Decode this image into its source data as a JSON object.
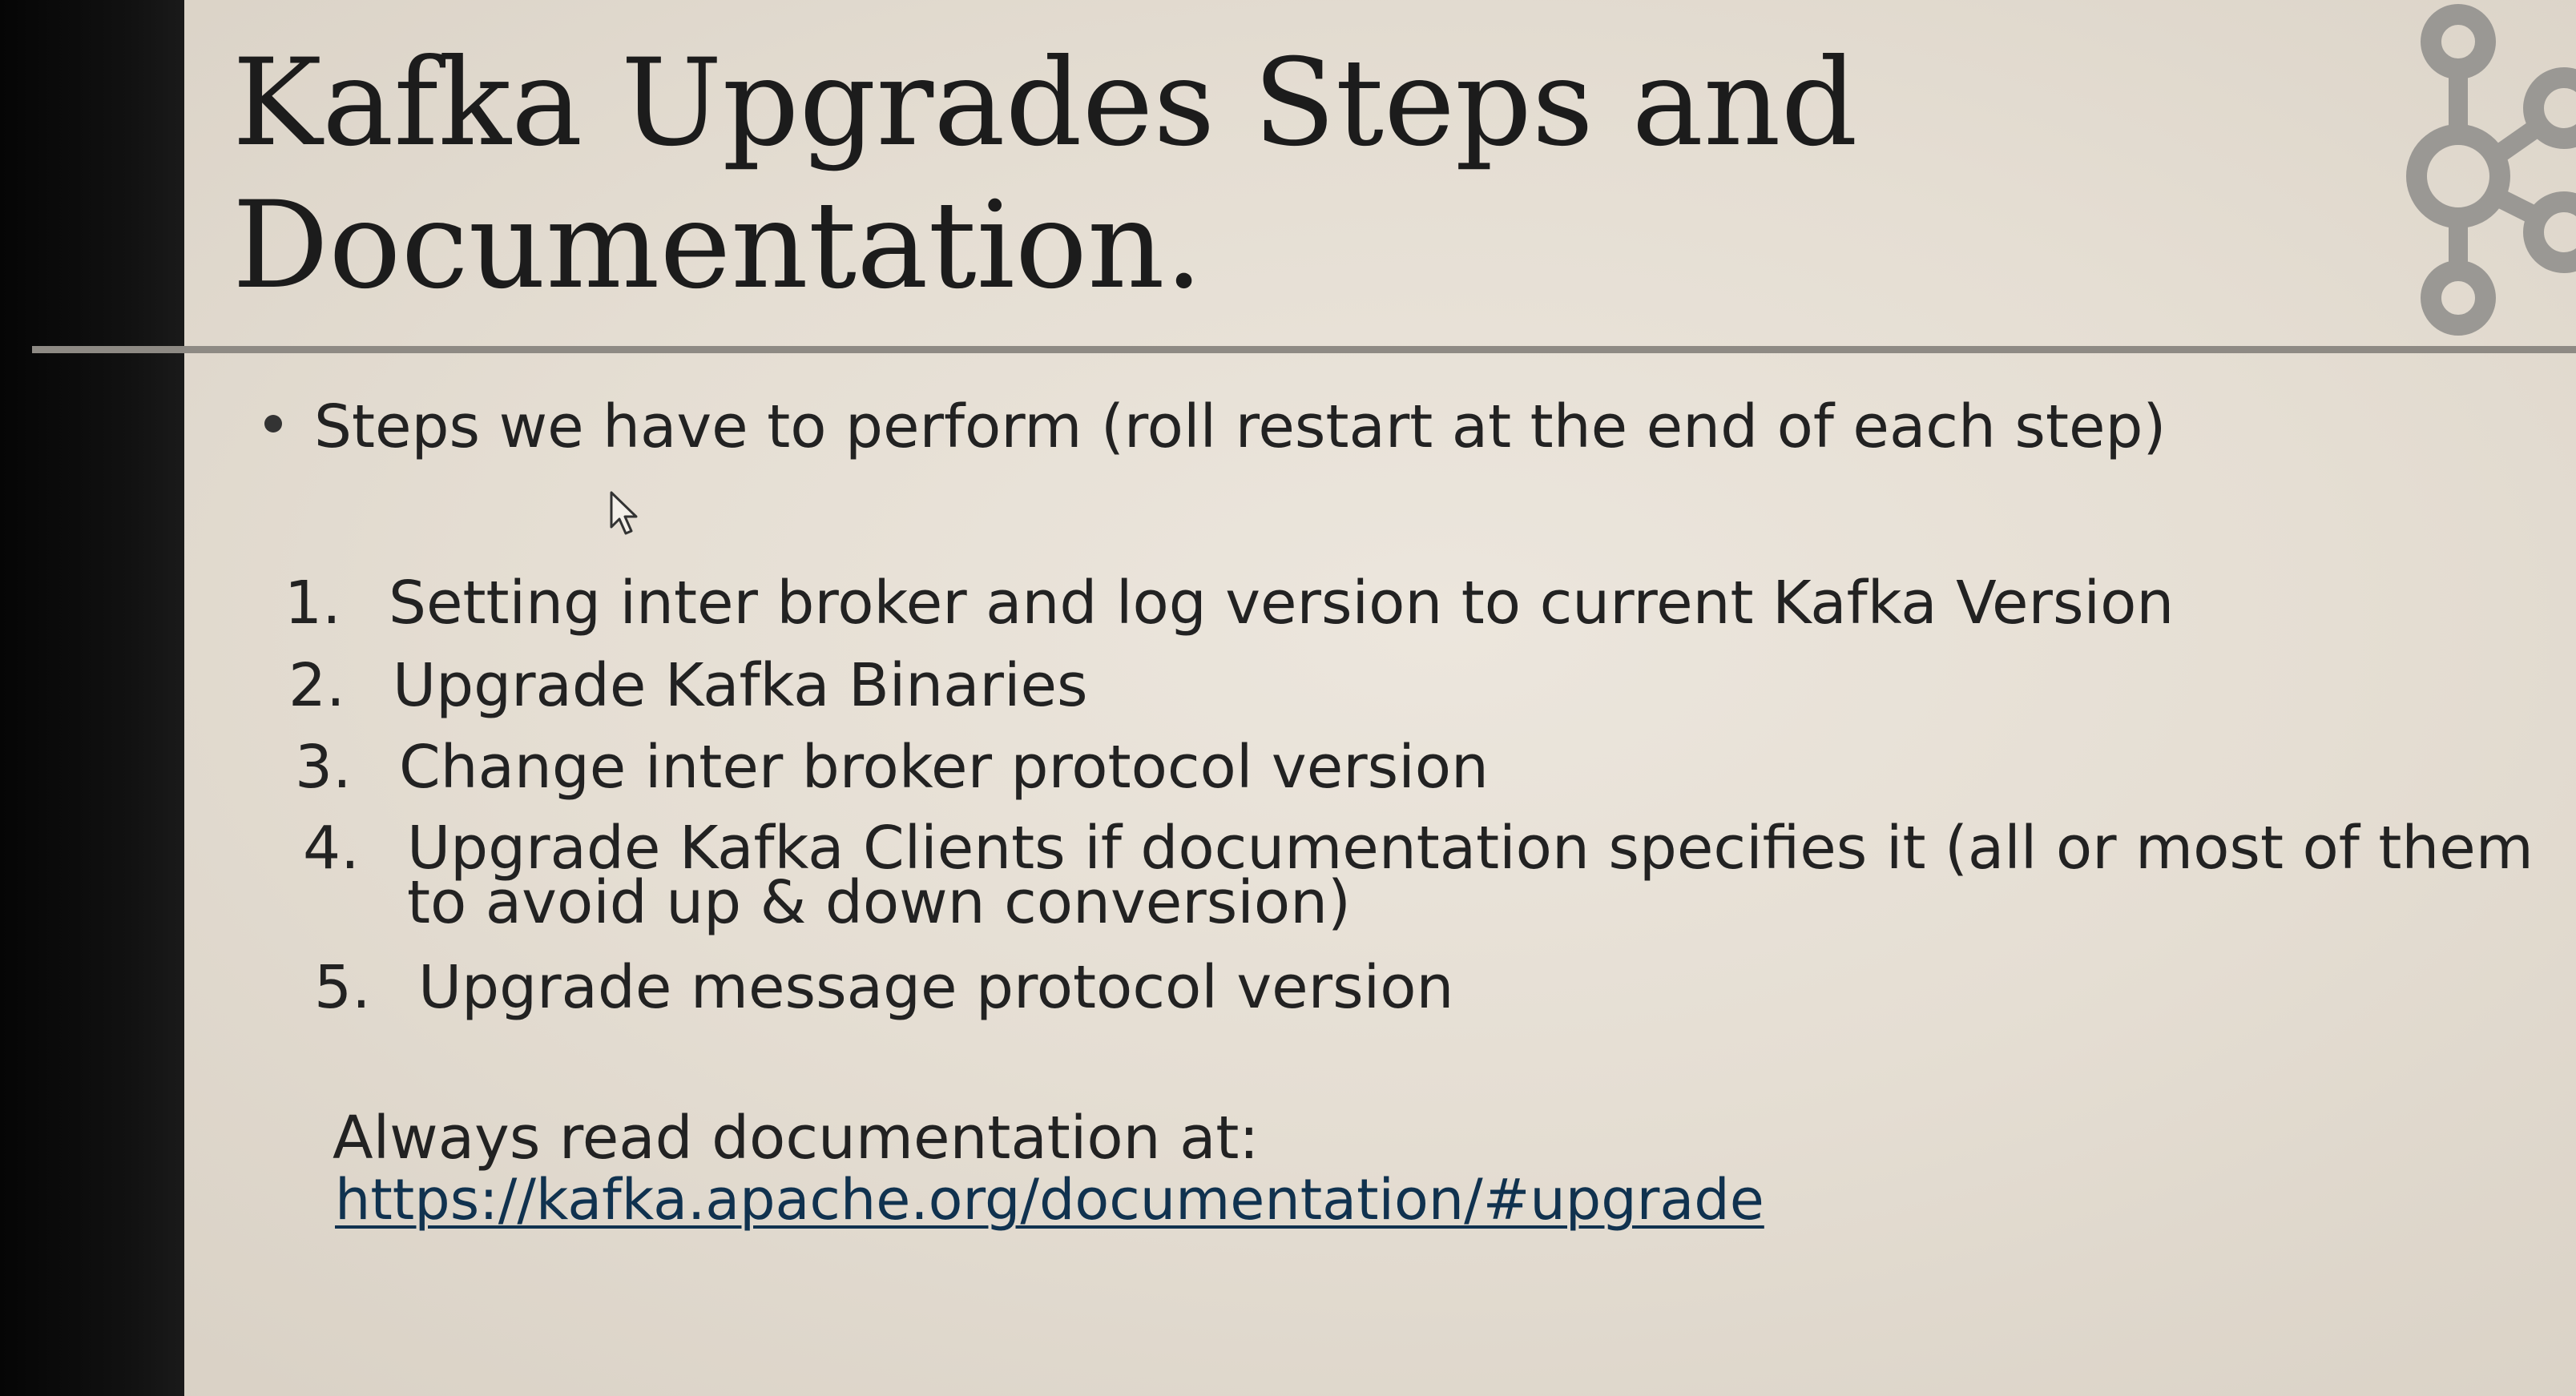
{
  "slide": {
    "title_line1": "Kafka Upgrades Steps and",
    "title_line2": "Documentation.",
    "bullet": "Steps we have to perform (roll restart at the end of each step)",
    "steps": [
      {
        "num": "1.",
        "text": "Setting inter broker and log version to current Kafka Version",
        "cont": ""
      },
      {
        "num": "2.",
        "text": "Upgrade Kafka Binaries",
        "cont": ""
      },
      {
        "num": "3.",
        "text": "Change inter broker protocol version",
        "cont": ""
      },
      {
        "num": "4.",
        "text": "Upgrade Kafka Clients if documentation specifies it (all or most of them",
        "cont": "to avoid up & down conversion)"
      },
      {
        "num": "5.",
        "text": "Upgrade message protocol version",
        "cont": ""
      }
    ],
    "read_doc": "Always read documentation at:",
    "link": "https://kafka.apache.org/documentation/#upgrade"
  },
  "icons": {
    "logo": "kafka-logo-icon",
    "cursor": "mouse-pointer-icon"
  },
  "colors": {
    "background": "#e8e2d8",
    "text": "#222222",
    "link": "#10324f",
    "divider": "#8e8a84",
    "logo": "#9a9894"
  }
}
